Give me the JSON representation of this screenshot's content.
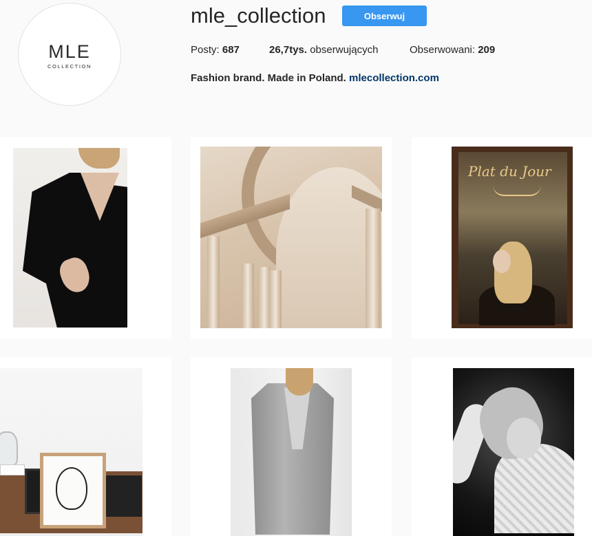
{
  "profile": {
    "logo_main": "MLE",
    "logo_sub": "COLLECTION",
    "username": "mle_collection",
    "follow_label": "Obserwuj",
    "follow_color": "#3897f0",
    "stats": {
      "posts_label": "Posty:",
      "posts_value": "687",
      "followers_value": "26,7tys.",
      "followers_label": "obserwujących",
      "following_label": "Obserwowani:",
      "following_value": "209"
    },
    "bio_text": "Fashion brand. Made in Poland.",
    "bio_link": "mlecollection.com",
    "link_color": "#003569"
  },
  "grid": {
    "posts": [
      {
        "subject": "woman in black velvet wrap dress"
      },
      {
        "subject": "arched stone ceiling with columns"
      },
      {
        "subject": "woman behind café window 'Plat du Jour'",
        "sign_text": "Plat du Jour"
      },
      {
        "subject": "interior with framed line-art face"
      },
      {
        "subject": "woman in long grey coat"
      },
      {
        "subject": "black and white woman in knit sweater"
      }
    ]
  }
}
